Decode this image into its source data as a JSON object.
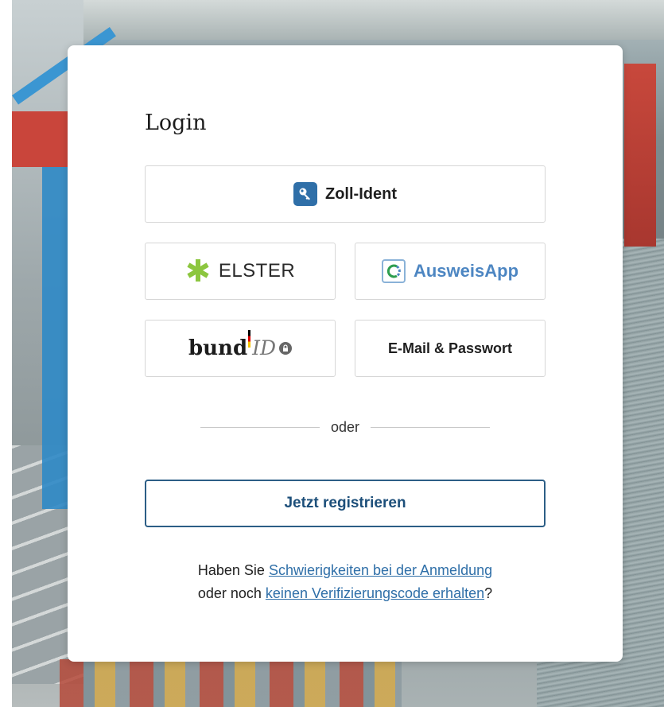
{
  "login": {
    "title": "Login",
    "zoll_ident": {
      "label": "Zoll-Ident",
      "icon": "key-icon",
      "icon_color": "#2f6fa8"
    },
    "elster": {
      "label": "ELSTER",
      "icon": "star-icon",
      "icon_color": "#8cc63f"
    },
    "ausweisapp": {
      "label": "AusweisApp",
      "icon": "ausweisapp-logo-icon",
      "color": "#4d86c2"
    },
    "bundid": {
      "label_bund": "bund",
      "label_id": "ID",
      "icon": "lock-icon"
    },
    "email": {
      "label": "E-Mail & Passwort"
    },
    "divider_text": "oder",
    "register_label": "Jetzt registrieren",
    "help": {
      "prefix": "Haben Sie ",
      "link1": "Schwierigkeiten bei der Anmeldung",
      "middle": "oder noch ",
      "link2": "keinen Verifizierungscode erhalten",
      "suffix": "?"
    }
  },
  "colors": {
    "primary": "#2c5e86",
    "link": "#2f6fa8",
    "border": "#d6d6d6"
  }
}
